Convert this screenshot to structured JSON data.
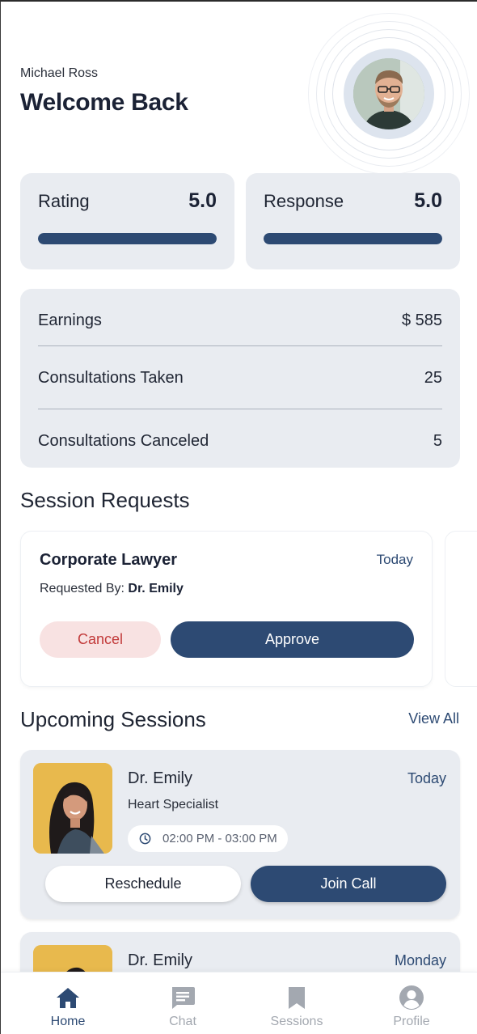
{
  "header": {
    "user_name": "Michael Ross",
    "welcome": "Welcome Back"
  },
  "stats": [
    {
      "label": "Rating",
      "value": "5.0",
      "progress": 1.0
    },
    {
      "label": "Response",
      "value": "5.0",
      "progress": 1.0
    }
  ],
  "summary": [
    {
      "label": "Earnings",
      "value": "$ 585"
    },
    {
      "label": "Consultations Taken",
      "value": "25"
    },
    {
      "label": "Consultations Canceled",
      "value": "5"
    }
  ],
  "session_requests": {
    "heading": "Session Requests",
    "items": [
      {
        "title": "Corporate Lawyer",
        "when": "Today",
        "requested_by_label": "Requested By: ",
        "requested_by": "Dr. Emily",
        "cancel_label": "Cancel",
        "approve_label": "Approve"
      }
    ]
  },
  "upcoming": {
    "heading": "Upcoming Sessions",
    "view_all": "View All",
    "items": [
      {
        "name": "Dr. Emily",
        "day": "Today",
        "specialty": "Heart Specialist",
        "time": "02:00 PM - 03:00 PM",
        "reschedule_label": "Reschedule",
        "join_label": "Join Call"
      },
      {
        "name": "Dr. Emily",
        "day": "Monday"
      }
    ]
  },
  "nav": [
    {
      "label": "Home",
      "icon": "home-icon",
      "active": true
    },
    {
      "label": "Chat",
      "icon": "chat-icon",
      "active": false
    },
    {
      "label": "Sessions",
      "icon": "bookmark-icon",
      "active": false
    },
    {
      "label": "Profile",
      "icon": "profile-icon",
      "active": false
    }
  ],
  "colors": {
    "primary": "#2d4a73",
    "card_bg": "#e9ecf1",
    "cancel_bg": "#f8e2e2",
    "cancel_text": "#c23a3a",
    "nav_inactive": "#a3a8b0"
  }
}
